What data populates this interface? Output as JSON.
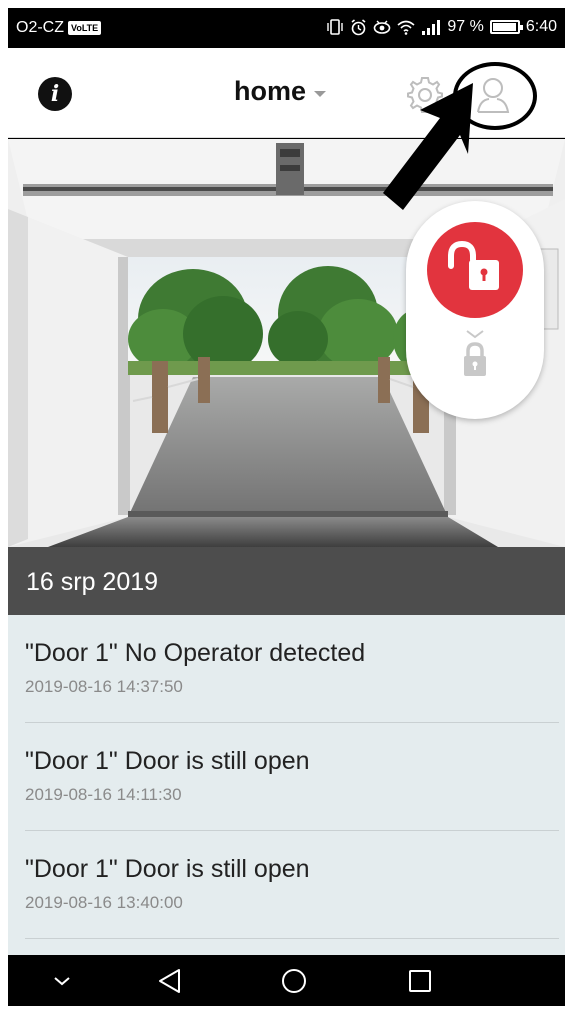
{
  "status_bar": {
    "carrier": "O2-CZ",
    "volte": "VoLTE",
    "battery_percent": "97 %",
    "battery_level": 0.97,
    "time": "6:40",
    "icons": [
      "vibrate-icon",
      "alarm-icon",
      "eye-icon",
      "wifi-icon",
      "signal-icon",
      "battery-icon"
    ]
  },
  "header": {
    "location": "home",
    "icons": [
      "info-icon",
      "gear-icon",
      "user-icon"
    ]
  },
  "lock_panel": {
    "active_state": "unlocked",
    "accent_color": "#e2343e"
  },
  "events_section": {
    "date_header": "16 srp 2019"
  },
  "events": [
    {
      "title": "\"Door 1\" No Operator detected",
      "time": "2019-08-16 14:37:50"
    },
    {
      "title": "\"Door 1\" Door is still open",
      "time": "2019-08-16 14:11:30"
    },
    {
      "title": "\"Door 1\" Door is still open",
      "time": "2019-08-16 13:40:00"
    }
  ],
  "nav_bar": {
    "icons": [
      "hide-keyboard-icon",
      "back-icon",
      "home-icon",
      "recents-icon"
    ]
  }
}
